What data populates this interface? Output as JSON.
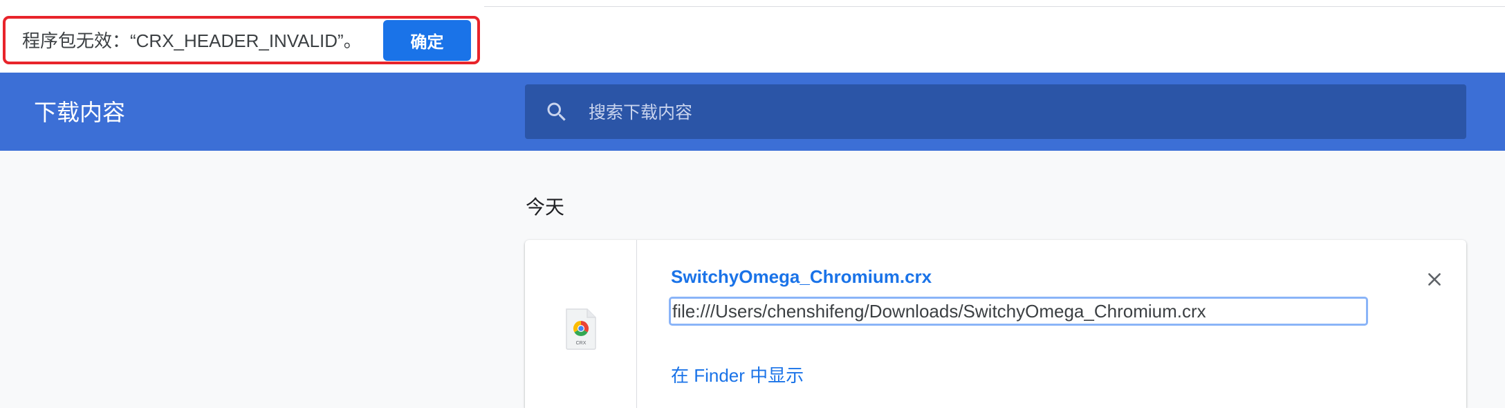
{
  "infobar": {
    "message": "程序包无效：“CRX_HEADER_INVALID”。",
    "confirm_label": "确定"
  },
  "header": {
    "title": "下载内容",
    "search_placeholder": "搜索下载内容"
  },
  "downloads": {
    "section_title": "今天",
    "items": [
      {
        "file_name": "SwitchyOmega_Chromium.crx",
        "url": "file:///Users/chenshifeng/Downloads/SwitchyOmega_Chromium.crx",
        "show_in_finder_label": "在 Finder 中显示",
        "icon_caption": "CRX"
      }
    ]
  },
  "colors": {
    "header_blue": "#3c6fd6",
    "search_blue": "#2b55a7",
    "link_blue": "#1a73e8",
    "highlight_red": "#e8242b"
  },
  "icons": {
    "search": "search-icon",
    "close": "close-icon",
    "file": "crx-file-icon"
  }
}
